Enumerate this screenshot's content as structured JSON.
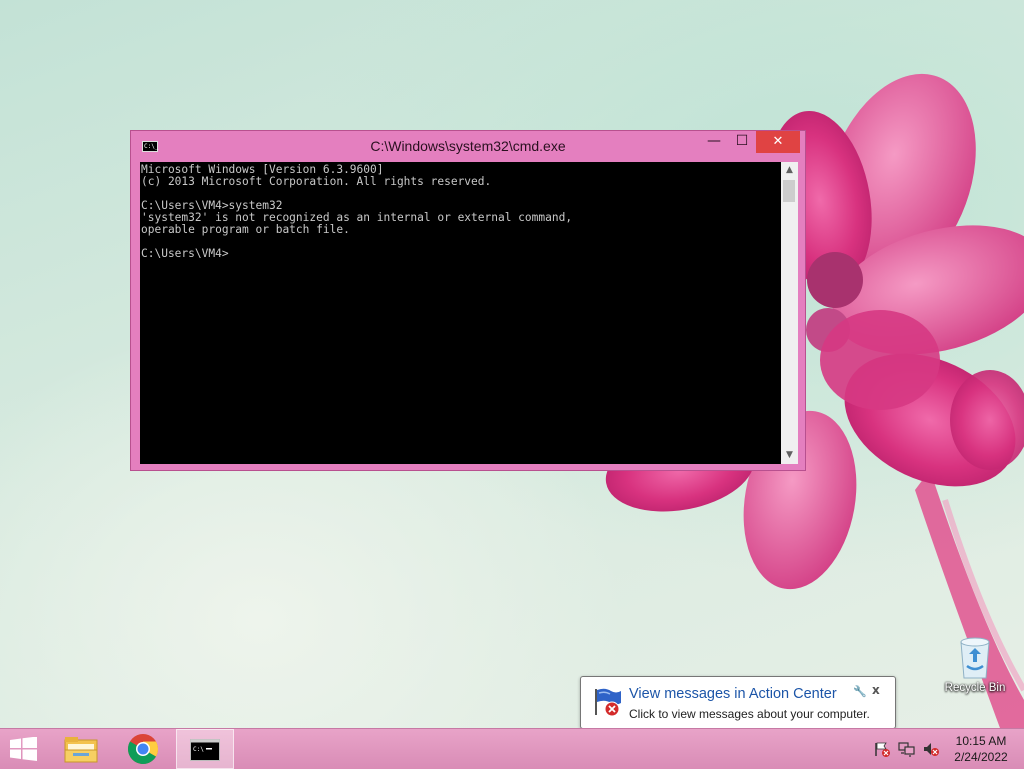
{
  "cmd_window": {
    "title": "C:\\Windows\\system32\\cmd.exe",
    "icon_text": "C:\\_",
    "minimize": "—",
    "maximize": "☐",
    "close": "✕",
    "console_lines": [
      "Microsoft Windows [Version 6.3.9600]",
      "(c) 2013 Microsoft Corporation. All rights reserved.",
      "",
      "C:\\Users\\VM4>system32",
      "'system32' is not recognized as an internal or external command,",
      "operable program or batch file.",
      "",
      "C:\\Users\\VM4>"
    ]
  },
  "desktop": {
    "recycle_bin_label": "Recycle Bin"
  },
  "notification": {
    "title": "View messages in Action Center",
    "message": "Click to view messages about your computer.",
    "close": "x"
  },
  "taskbar": {
    "pinned": [
      "file-explorer",
      "google-chrome",
      "command-prompt"
    ],
    "time": "10:15 AM",
    "date": "2/24/2022"
  },
  "colors": {
    "window_frame": "#e47fbf",
    "taskbar": "#e0a0c4",
    "close_button": "#e04343",
    "notification_title": "#1c55a8"
  }
}
